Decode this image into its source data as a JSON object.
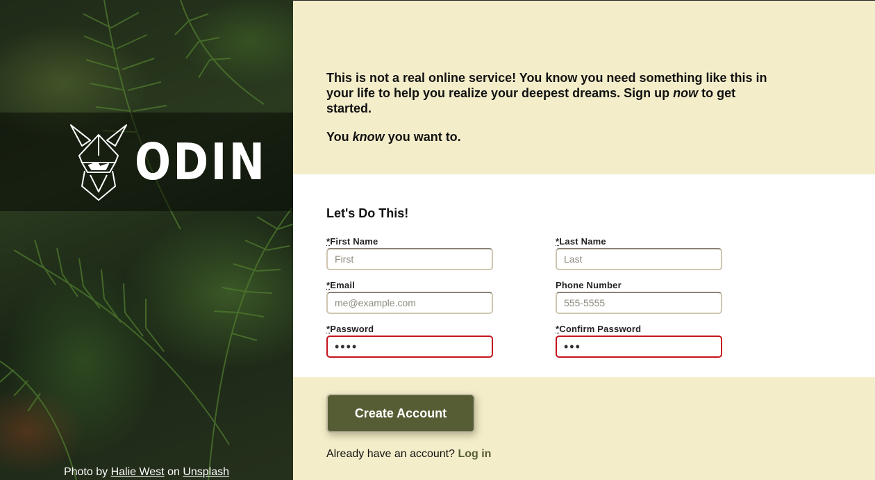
{
  "hero": {
    "brand": "ODIN",
    "credit_prefix": "Photo by",
    "credit_author": "Halie West",
    "credit_middle": "on",
    "credit_source": "Unsplash"
  },
  "intro": {
    "p1_a": "This is not a real online service! You know you need something like this in your life to help you realize your deepest dreams. Sign up ",
    "p1_em": "now",
    "p1_b": " to get started.",
    "p2_a": "You ",
    "p2_em": "know",
    "p2_b": " you want to."
  },
  "form": {
    "title": "Let's Do This!",
    "required_mark": "*",
    "first_name": {
      "label": "First Name",
      "placeholder": "First",
      "required": true
    },
    "last_name": {
      "label": "Last Name",
      "placeholder": "Last",
      "required": true
    },
    "email": {
      "label": "Email",
      "placeholder": "me@example.com",
      "required": true
    },
    "phone": {
      "label": "Phone Number",
      "placeholder": "555-5555",
      "required": false
    },
    "password": {
      "label": "Password",
      "value": "abcd",
      "required": true
    },
    "confirm_password": {
      "label": "Confirm Password",
      "value": "abc",
      "required": true
    }
  },
  "footer": {
    "submit_label": "Create Account",
    "login_prompt": "Already have an account?",
    "login_link": "Log in"
  },
  "colors": {
    "accent": "#565d34",
    "cream": "#f3edc9",
    "invalid": "#c4141c"
  }
}
